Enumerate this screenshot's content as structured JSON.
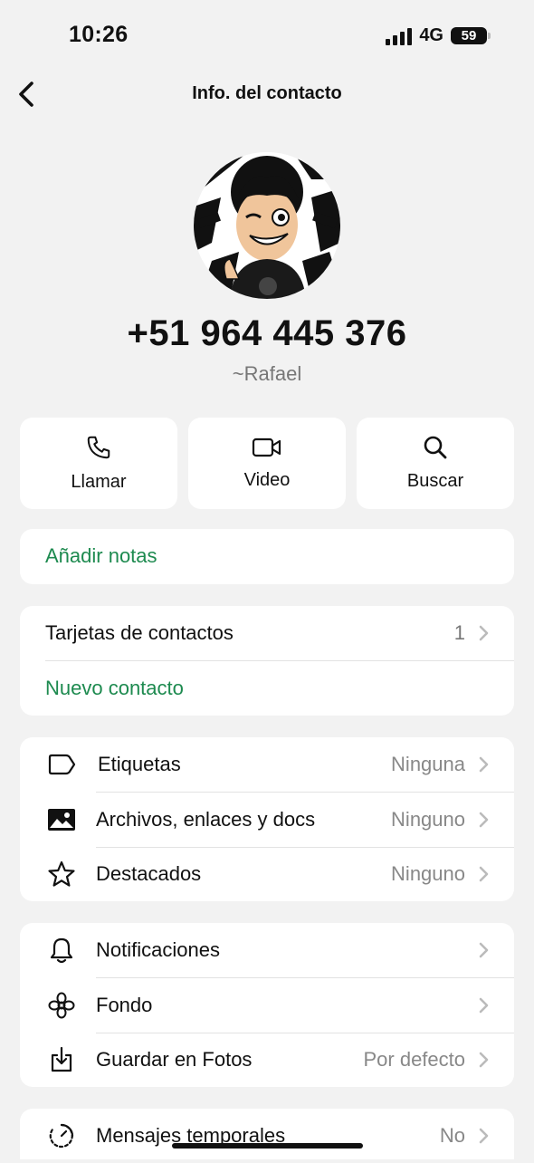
{
  "status_bar": {
    "time": "10:26",
    "network": "4G",
    "battery": "59"
  },
  "header": {
    "title": "Info. del contacto"
  },
  "contact": {
    "phone": "+51 964 445 376",
    "alias": "~Rafael"
  },
  "actions": [
    {
      "label": "Llamar",
      "icon": "phone-icon"
    },
    {
      "label": "Video",
      "icon": "video-icon"
    },
    {
      "label": "Buscar",
      "icon": "search-icon"
    }
  ],
  "notes": {
    "label": "Añadir notas"
  },
  "contact_cards": {
    "label": "Tarjetas de contactos",
    "count": "1",
    "new_contact": "Nuevo contacto"
  },
  "media_section": [
    {
      "label": "Etiquetas",
      "value": "Ninguna",
      "icon": "label-icon"
    },
    {
      "label": "Archivos, enlaces y docs",
      "value": "Ninguno",
      "icon": "image-icon"
    },
    {
      "label": "Destacados",
      "value": "Ninguno",
      "icon": "star-icon"
    }
  ],
  "settings_section": [
    {
      "label": "Notificaciones",
      "value": "",
      "icon": "bell-icon"
    },
    {
      "label": "Fondo",
      "value": "",
      "icon": "flower-icon"
    },
    {
      "label": "Guardar en Fotos",
      "value": "Por defecto",
      "icon": "save-download-icon"
    }
  ],
  "disappearing": {
    "label": "Mensajes temporales",
    "value": "No",
    "icon": "timer-icon"
  },
  "colors": {
    "accent_green": "#1d8a4f",
    "background": "#f2f2f2"
  }
}
